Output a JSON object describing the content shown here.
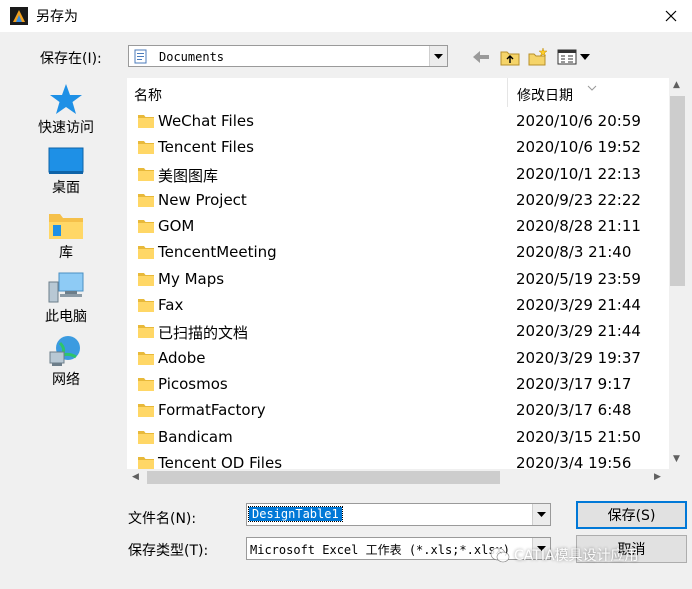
{
  "window": {
    "title": "另存为",
    "close": "✕"
  },
  "save_in": {
    "label": "保存在(I):",
    "value": "Documents"
  },
  "toolbar": {
    "back": "back-arrow-icon",
    "up": "folder-up-icon",
    "new_folder": "new-folder-icon",
    "view_menu": "view-menu-icon"
  },
  "places": [
    {
      "label": "快速访问",
      "icon": "quick-access-star-icon"
    },
    {
      "label": "桌面",
      "icon": "desktop-icon"
    },
    {
      "label": "库",
      "icon": "library-icon"
    },
    {
      "label": "此电脑",
      "icon": "this-pc-icon"
    },
    {
      "label": "网络",
      "icon": "network-icon"
    }
  ],
  "columns": {
    "name": "名称",
    "date": "修改日期"
  },
  "files": [
    {
      "name": "WeChat Files",
      "date": "2020/10/6 20:59"
    },
    {
      "name": "Tencent Files",
      "date": "2020/10/6 19:52"
    },
    {
      "name": "美图图库",
      "date": "2020/10/1 22:13"
    },
    {
      "name": "New Project",
      "date": "2020/9/23 22:22"
    },
    {
      "name": "GOM",
      "date": "2020/8/28 21:11"
    },
    {
      "name": "TencentMeeting",
      "date": "2020/8/3 21:40"
    },
    {
      "name": "My Maps",
      "date": "2020/5/19 23:59"
    },
    {
      "name": "Fax",
      "date": "2020/3/29 21:44"
    },
    {
      "name": "已扫描的文档",
      "date": "2020/3/29 21:44"
    },
    {
      "name": "Adobe",
      "date": "2020/3/29 19:37"
    },
    {
      "name": "Picosmos",
      "date": "2020/3/17 9:17"
    },
    {
      "name": "FormatFactory",
      "date": "2020/3/17 6:48"
    },
    {
      "name": "Bandicam",
      "date": "2020/3/15 21:50"
    },
    {
      "name": "Tencent OD Files",
      "date": "2020/3/4 19:56"
    }
  ],
  "filename": {
    "label": "文件名(N):",
    "value": "DesignTable1"
  },
  "filetype": {
    "label": "保存类型(T):",
    "value": "Microsoft Excel 工作表 (*.xls;*.xlsx)"
  },
  "buttons": {
    "save": "保存(S)",
    "cancel": "取消"
  },
  "watermark": "CATIA模具设计应用",
  "colors": {
    "folder": "#ffd766",
    "selection": "#0078d7",
    "icon_blue": "#1e90e6"
  }
}
